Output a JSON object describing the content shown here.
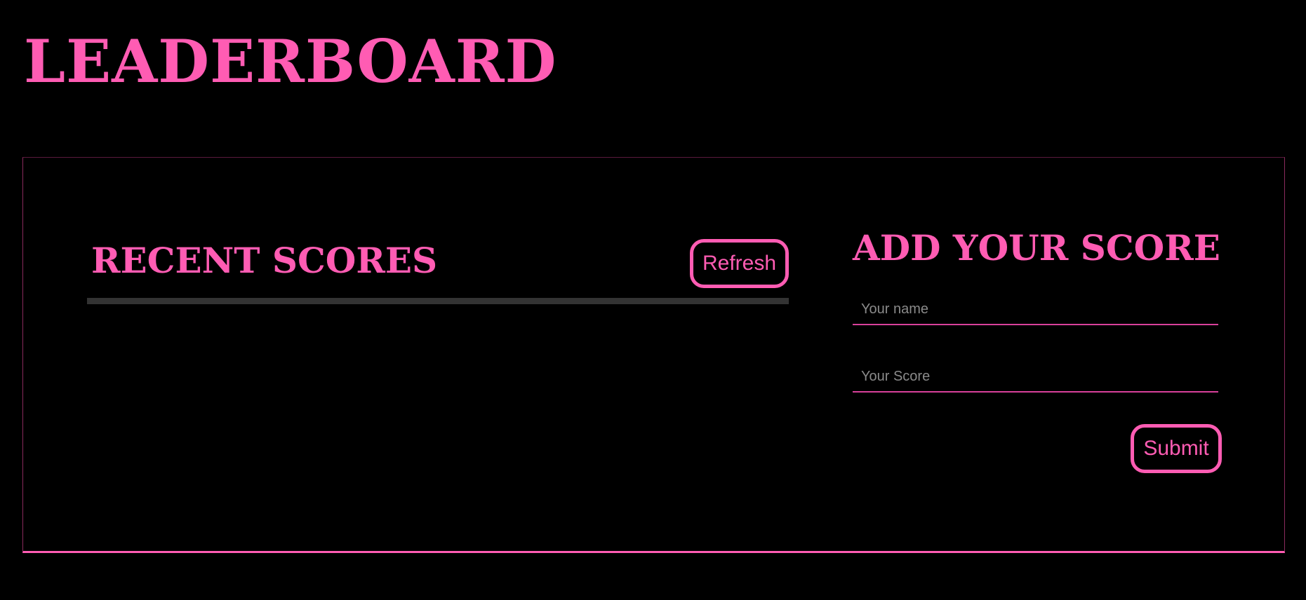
{
  "page": {
    "title": "LEADERBOARD"
  },
  "recent": {
    "title": "RECENT SCORES",
    "refresh_label": "Refresh"
  },
  "add_score": {
    "title": "ADD YOUR SCORE",
    "name_placeholder": "Your name",
    "name_value": "",
    "score_placeholder": "Your Score",
    "score_value": "",
    "submit_label": "Submit"
  },
  "colors": {
    "background": "#000000",
    "accent": "#ff5cb3",
    "divider": "#333333",
    "placeholder": "#8a8a8a"
  }
}
